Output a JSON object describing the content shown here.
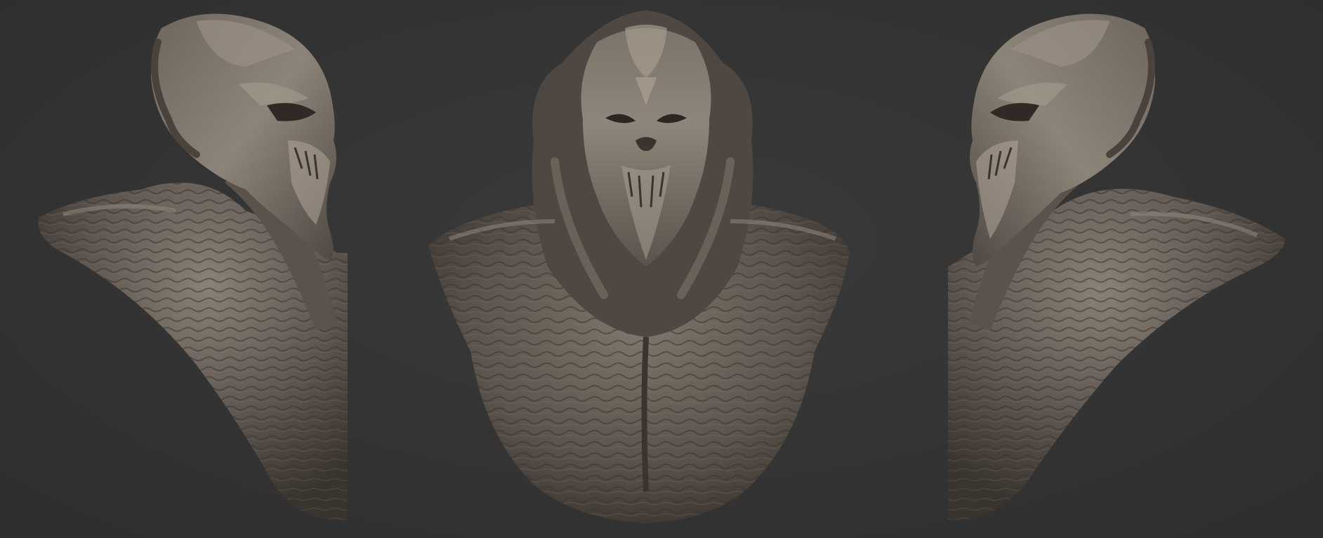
{
  "scene": {
    "background_color": "#353535",
    "material_color": "#6b635c",
    "highlight_color": "#a89e92",
    "shadow_color": "#2a2622",
    "views": [
      {
        "name": "left-profile"
      },
      {
        "name": "front"
      },
      {
        "name": "right-profile"
      }
    ]
  }
}
